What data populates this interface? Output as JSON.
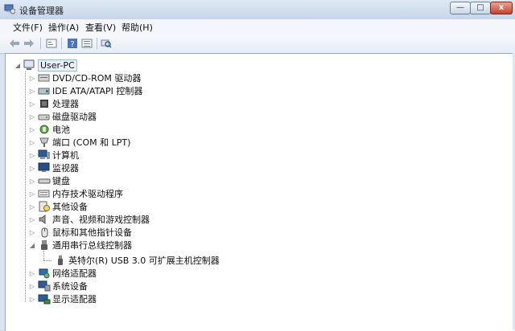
{
  "window": {
    "title": "设备管理器"
  },
  "controls": {
    "minimize": "—",
    "maximize": "□",
    "close": "x"
  },
  "menu": [
    {
      "label": "文件(F)"
    },
    {
      "label": "操作(A)"
    },
    {
      "label": "查看(V)"
    },
    {
      "label": "帮助(H)"
    }
  ],
  "toolbar": [
    {
      "icon": "back-arrow-icon"
    },
    {
      "icon": "forward-arrow-icon"
    },
    {
      "icon": "properties-icon"
    },
    {
      "icon": "help-icon"
    },
    {
      "icon": "list-view-icon"
    },
    {
      "icon": "scan-hardware-icon"
    }
  ],
  "tree": {
    "root": {
      "label": "User-PC",
      "icon": "computer-icon"
    },
    "items": [
      {
        "label": "DVD/CD-ROM 驱动器",
        "icon": "cdrom-icon"
      },
      {
        "label": "IDE ATA/ATAPI 控制器",
        "icon": "ide-controller-icon"
      },
      {
        "label": "处理器",
        "icon": "processor-icon"
      },
      {
        "label": "磁盘驱动器",
        "icon": "disk-drive-icon"
      },
      {
        "label": "电池",
        "icon": "battery-icon"
      },
      {
        "label": "端口 (COM 和 LPT)",
        "icon": "port-icon"
      },
      {
        "label": "计算机",
        "icon": "computer-icon"
      },
      {
        "label": "监视器",
        "icon": "monitor-icon"
      },
      {
        "label": "键盘",
        "icon": "keyboard-icon"
      },
      {
        "label": "内存技术驱动程序",
        "icon": "memory-icon"
      },
      {
        "label": "其他设备",
        "icon": "unknown-device-icon"
      },
      {
        "label": "声音、视频和游戏控制器",
        "icon": "sound-icon"
      },
      {
        "label": "鼠标和其他指针设备",
        "icon": "mouse-icon"
      },
      {
        "label": "通用串行总线控制器",
        "icon": "usb-icon",
        "expanded": true,
        "children": [
          {
            "label": "英特尔(R) USB 3.0 可扩展主机控制器",
            "icon": "usb-device-icon"
          }
        ]
      },
      {
        "label": "网络适配器",
        "icon": "network-icon"
      },
      {
        "label": "系统设备",
        "icon": "system-device-icon"
      },
      {
        "label": "显示适配器",
        "icon": "display-adapter-icon"
      }
    ]
  }
}
